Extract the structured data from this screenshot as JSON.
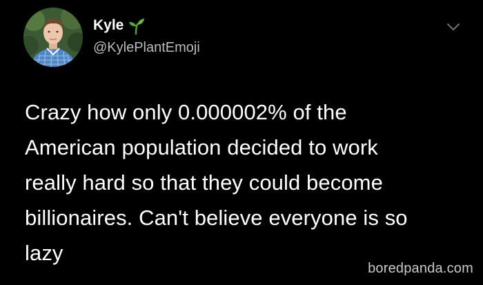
{
  "user": {
    "display_name": "Kyle",
    "handle": "@KylePlantEmoji"
  },
  "tweet": {
    "lines": [
      "Crazy how only 0.000002% of the",
      "American population decided to work",
      "really hard so that they could become",
      "billionaires. Can't believe everyone is so",
      "lazy"
    ]
  },
  "watermark": "boredpanda.com",
  "icons": {
    "name_badge": "sprout-icon",
    "menu": "chevron-down-icon"
  },
  "colors": {
    "background": "#000000",
    "text": "#ffffff",
    "handle": "#b9bcc0",
    "sprout": "#5aa23c",
    "watermark": "#c9c9c9"
  }
}
